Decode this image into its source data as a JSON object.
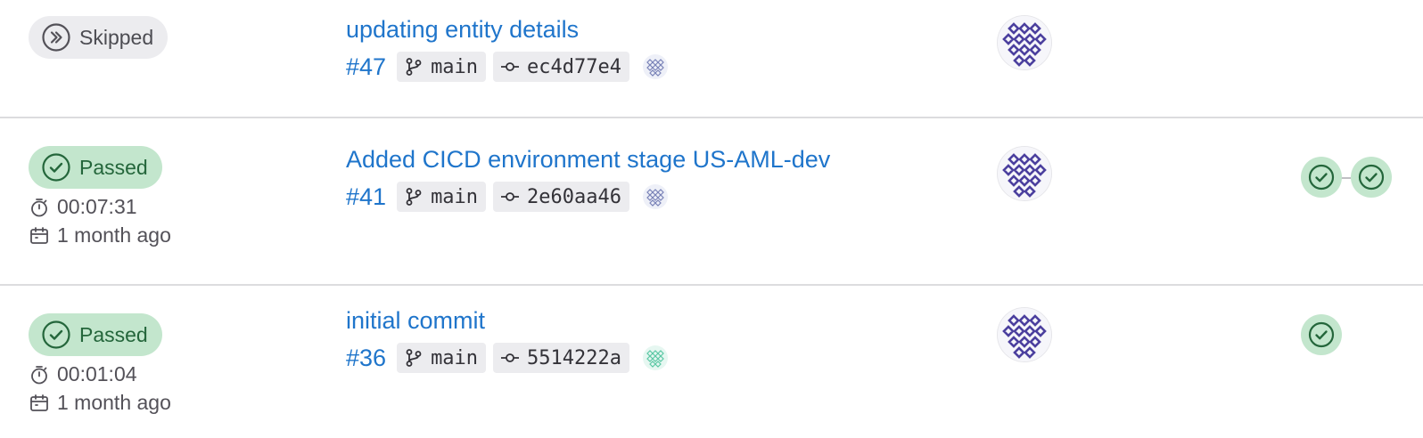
{
  "colors": {
    "link": "#1f75cb",
    "passed_bg": "#c3e6cd",
    "passed_fg": "#24663b",
    "skipped_bg": "#ececef",
    "avatar_purple": "#4b3f9e"
  },
  "pipelines": [
    {
      "status": "Skipped",
      "duration": "",
      "finished": "",
      "title": "updating entity details",
      "id": "#47",
      "branch": "main",
      "commit": "ec4d77e4",
      "stages": 0
    },
    {
      "status": "Passed",
      "duration": "00:07:31",
      "finished": "1 month ago",
      "title": "Added CICD environment stage US-AML-dev",
      "id": "#41",
      "branch": "main",
      "commit": "2e60aa46",
      "stages": 2
    },
    {
      "status": "Passed",
      "duration": "00:01:04",
      "finished": "1 month ago",
      "title": "initial commit",
      "id": "#36",
      "branch": "main",
      "commit": "5514222a",
      "stages": 1
    }
  ],
  "icons": {
    "skipped": "skipped-status-icon",
    "passed": "passed-status-icon",
    "duration": "timer-icon",
    "finished": "calendar-icon",
    "branch": "branch-icon",
    "commit": "commit-icon",
    "stage": "stage-success-icon"
  }
}
